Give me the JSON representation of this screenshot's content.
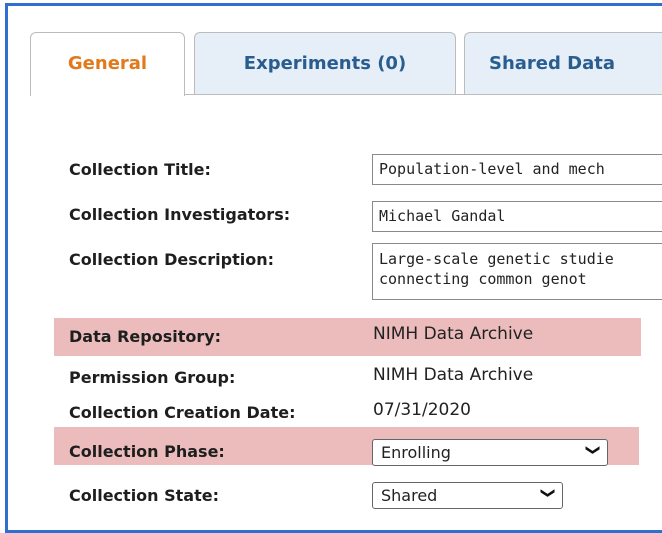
{
  "tabs": [
    {
      "label": "General",
      "active": true
    },
    {
      "label": "Experiments (0)",
      "active": false
    },
    {
      "label": "Shared Data",
      "active": false
    }
  ],
  "fields": {
    "title": {
      "label": "Collection Title:",
      "value": "Population-level and mech"
    },
    "investigators": {
      "label": "Collection Investigators:",
      "value": "Michael Gandal"
    },
    "description": {
      "label": "Collection Description:",
      "line1": "Large-scale genetic studie",
      "line2": "connecting common genot"
    },
    "repository": {
      "label": "Data Repository:",
      "value": "NIMH Data Archive"
    },
    "permission": {
      "label": "Permission Group:",
      "value": "NIMH Data Archive"
    },
    "creation_date": {
      "label": "Collection Creation Date:",
      "value": "07/31/2020"
    },
    "phase": {
      "label": "Collection Phase:",
      "value": "Enrolling"
    },
    "state": {
      "label": "Collection State:",
      "value": "Shared"
    }
  },
  "colors": {
    "border": "#2e6fcf",
    "active_tab_text": "#e07a1b",
    "tab_text": "#2a5d8f",
    "highlight": "#ecbcbc"
  },
  "icons": {
    "dropdown": "chevron-down-icon"
  }
}
